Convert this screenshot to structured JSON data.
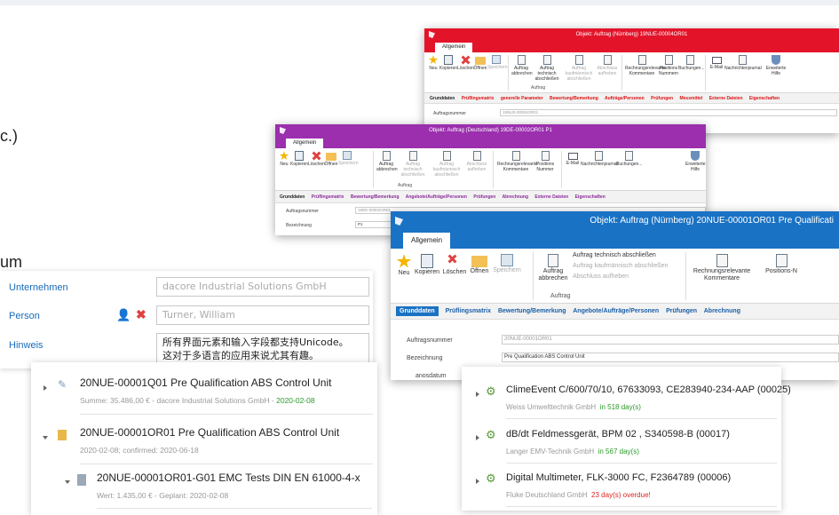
{
  "left_fragments": {
    "etc": "c.)",
    "um": "um"
  },
  "red_window": {
    "title": "Objekt: Auftrag (Nürnberg) 19NUE-00004OR01",
    "tab": "Allgemein",
    "buttons": [
      "Neu",
      "Kopieren",
      "Löschen",
      "Öffnen",
      "Speichern",
      "Auftrag abbrechen",
      "Auftrag technisch abschließen",
      "Auftrag kaufmännisch abschließen",
      "Abschluss aufheben",
      "Rechnungsrelevante Kommentare",
      "Positions Nummern",
      "Buchungen...",
      "E-Mail",
      "Nachrichtenjournal",
      "Erweiterte Hilfe"
    ],
    "group": "Auftrag",
    "navtabs": [
      "Grunddaten",
      "Prüflingsmatrix",
      "generelle Parameter",
      "Bewertung/Bemerkung",
      "Aufträge/Personen",
      "Prüfungen",
      "Messmittel",
      "Externe Dateien",
      "Eigenschaften"
    ],
    "field_label": "Auftragsnummer",
    "field_value": "19NUE-00004OR01"
  },
  "purple_window": {
    "title": "Objekt: Auftrag (Deutschland) 19DE-00002OR01 P1",
    "tab": "Allgemein",
    "buttons": [
      "Neu",
      "Kopieren",
      "Löschen",
      "Öffnen",
      "Speichern",
      "Auftrag abbrechen",
      "Auftrag technisch abschließen",
      "Auftrag kaufmännisch abschließen",
      "Abschluss aufheben",
      "Rechnungsrelevante Kommentare",
      "Positions Nummer",
      "E-Mail",
      "Nachrichtenjournal",
      "Buchungen...",
      "Erweiterte Hilfe"
    ],
    "group": "Auftrag",
    "navtabs": [
      "Grunddaten",
      "Prüflingsmatrix",
      "Bewertung/Bemerkung",
      "Angebote/Aufträge/Personen",
      "Prüfungen",
      "Abrechnung",
      "Externe Dateien",
      "Eigenschaften"
    ],
    "fields": [
      {
        "label": "Auftragsnummer",
        "value": "19DE-00002OR01"
      },
      {
        "label": "Bezeichnung",
        "value": "P1"
      }
    ]
  },
  "blue_window": {
    "title": "Objekt: Auftrag (Nürnberg) 20NUE-00001OR01 Pre Qualificati",
    "tab": "Allgemein",
    "buttons": [
      "Neu",
      "Kopieren",
      "Löschen",
      "Öffnen",
      "Speichern",
      "Auftrag abbrechen",
      "Auftrag technisch abschließen",
      "Auftrag kaufmännisch abschließen",
      "Abschluss aufheben",
      "Rechnungsrelevante Kommentare",
      "Positions-N"
    ],
    "group": "Auftrag",
    "navtabs": [
      "Grunddaten",
      "Prüflingsmatrix",
      "Bewertung/Bemerkung",
      "Angebote/Aufträge/Personen",
      "Prüfungen",
      "Abrechnung"
    ],
    "fields": [
      {
        "label": "Auftragsnummer",
        "value": "20NUE-00001OR01"
      },
      {
        "label": "Bezeichnung",
        "value": "Pre Qualification ABS Control Unit"
      },
      {
        "label": "anosdatum",
        "value": ""
      }
    ]
  },
  "form": {
    "rows": [
      {
        "label": "Unternehmen",
        "value": "dacore Industrial Solutions GmbH"
      },
      {
        "label": "Person",
        "value": "Turner, William"
      },
      {
        "label": "Hinweis",
        "value": "所有界面元素和输入字段都支持Unicode。",
        "value2": "这对于多语言的应用来说尤其有趣。"
      }
    ]
  },
  "tree": [
    {
      "title": "20NUE-00001Q01 Pre Qualification ABS Control Unit",
      "sub": "Summe: 35.486,00 € - dacore Industrial Solutions GmbH - ",
      "sub_date": "2020-02-08"
    },
    {
      "title": "20NUE-00001OR01 Pre Qualification ABS Control Unit",
      "sub": "2020-02-08; confirmed: 2020-06-18"
    },
    {
      "title": "20NUE-00001OR01-G01 EMC Tests DIN EN 61000-4-x",
      "sub": "Wert: 1.435,00 € - Geplant: 2020-02-08"
    }
  ],
  "devices": [
    {
      "title": "ClimeEvent C/600/70/10, 67633093, CE283940-234-AAP (00025)",
      "company": "Weiss Umwelttechnik GmbH",
      "status": "in 518 day(s)",
      "status_color": "#2a9a2a"
    },
    {
      "title": "dB/dt Feldmessgerät, BPM 02 , S340598-B (00017)",
      "company": "Langer EMV-Technik GmbH",
      "status": "in 567 day(s)",
      "status_color": "#2a9a2a"
    },
    {
      "title": "Digital Multimeter, FLK-3000 FC, F2364789 (00006)",
      "company": "Fluke Deutschland GmbH",
      "status": "23 day(s) overdue!",
      "status_color": "#e02020"
    }
  ]
}
